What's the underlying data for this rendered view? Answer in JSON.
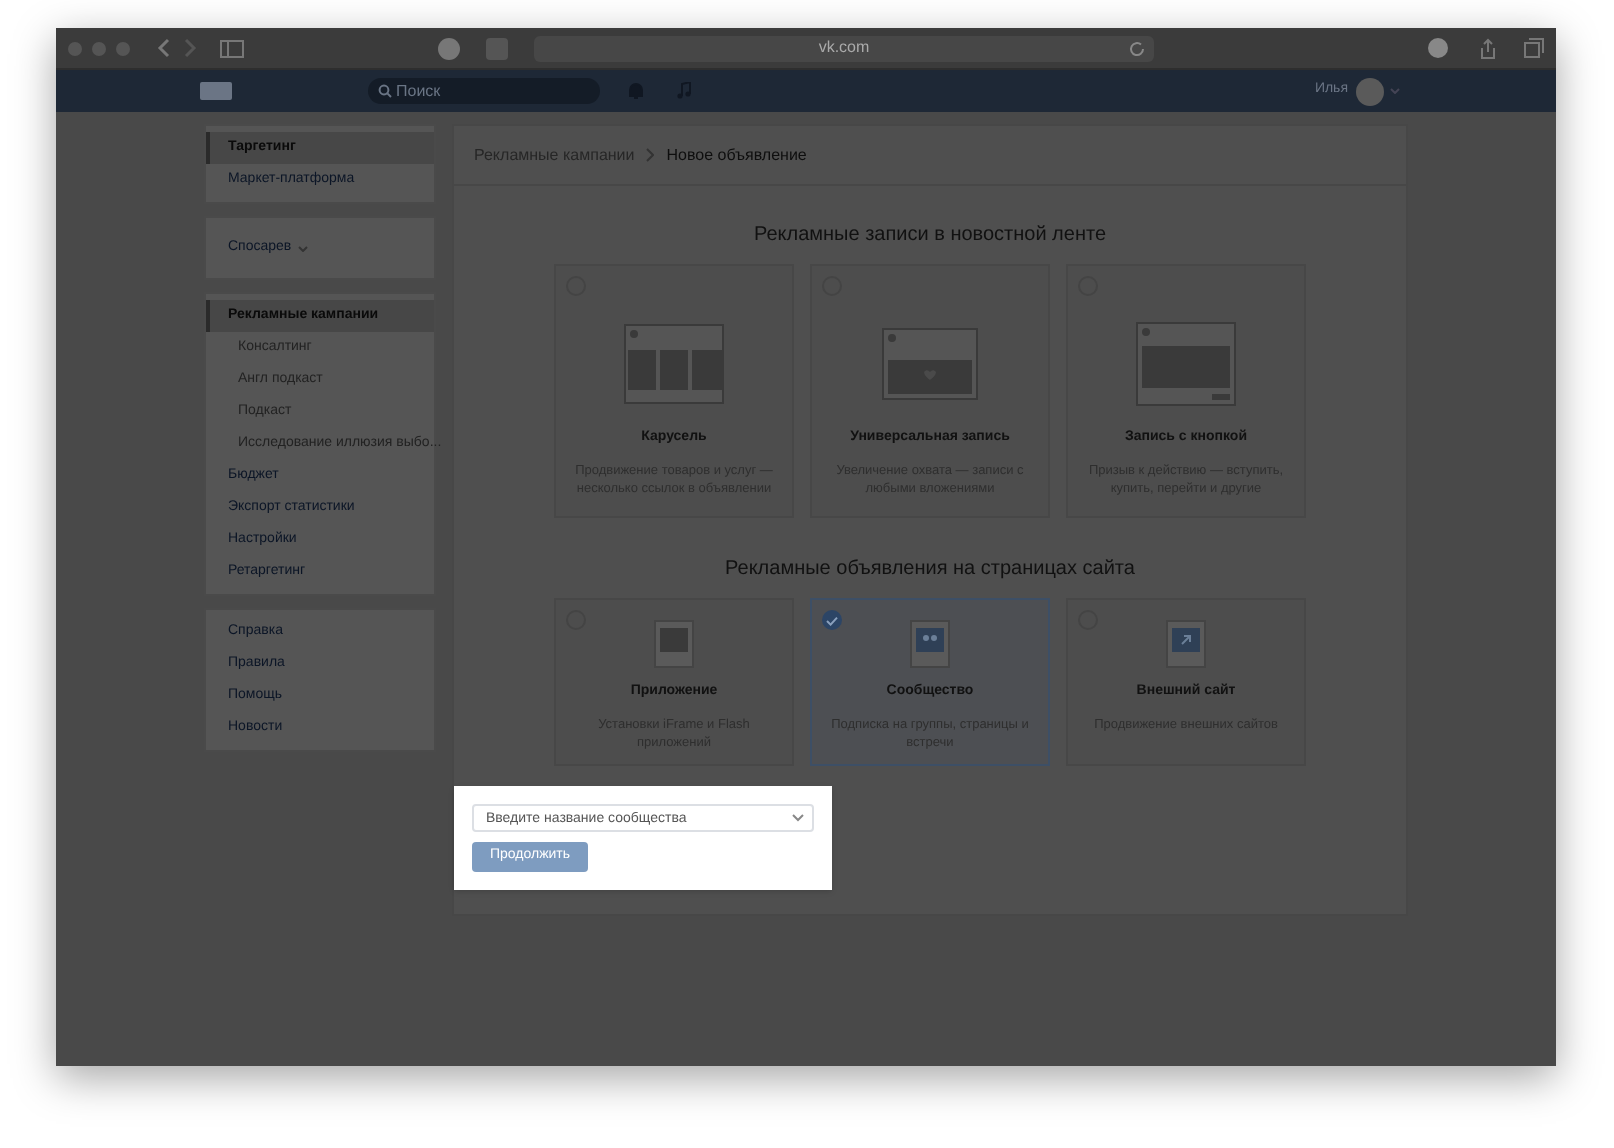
{
  "browser": {
    "url": "vk.com"
  },
  "header": {
    "search_placeholder": "Поиск",
    "user_name": "Илья"
  },
  "sidebar": {
    "groups": [
      [
        {
          "label": "Таргетинг",
          "kind": "link",
          "selected": true
        },
        {
          "label": "Маркет-платформа",
          "kind": "link",
          "selected": false
        }
      ],
      [
        {
          "label": "Спосарев",
          "kind": "dropdown",
          "selected": false
        }
      ],
      [
        {
          "label": "Рекламные кампании",
          "kind": "link",
          "selected": true
        },
        {
          "label": "Консалтинг",
          "kind": "sub",
          "selected": false
        },
        {
          "label": "Англ подкаст",
          "kind": "sub",
          "selected": false
        },
        {
          "label": "Подкаст",
          "kind": "sub",
          "selected": false
        },
        {
          "label": "Исследование иллюзия выбо...",
          "kind": "sub",
          "selected": false
        },
        {
          "label": "Бюджет",
          "kind": "link",
          "selected": false
        },
        {
          "label": "Экспорт статистики",
          "kind": "link",
          "selected": false
        },
        {
          "label": "Настройки",
          "kind": "link",
          "selected": false
        },
        {
          "label": "Ретаргетинг",
          "kind": "link",
          "selected": false
        }
      ],
      [
        {
          "label": "Справка",
          "kind": "help",
          "selected": false
        },
        {
          "label": "Правила",
          "kind": "help",
          "selected": false
        },
        {
          "label": "Помощь",
          "kind": "help",
          "selected": false
        },
        {
          "label": "Новости",
          "kind": "help",
          "selected": false
        }
      ]
    ]
  },
  "breadcrumbs": [
    "Рекламные кампании",
    "Новое объявление"
  ],
  "sections": [
    {
      "title": "Рекламные записи в новостной ленте",
      "cards": [
        {
          "kind": "carousel",
          "title": "Карусель",
          "description": "Продвижение товаров и услуг — несколько ссылок в объявлении",
          "selected": false
        },
        {
          "kind": "universal",
          "title": "Универсальная запись",
          "description": "Увеличение охвата — записи с любыми вложениями",
          "selected": false
        },
        {
          "kind": "button",
          "title": "Запись с кнопкой",
          "description": "Призыв к действию — вступить, купить, перейти и другие",
          "selected": false
        }
      ]
    },
    {
      "title": "Рекламные объявления на страницах сайта",
      "cards": [
        {
          "kind": "app",
          "title": "Приложение",
          "description": "Установки iFrame и Flash приложений",
          "selected": false
        },
        {
          "kind": "community",
          "title": "Сообщество",
          "description": "Подписка на группы, страницы и встречи",
          "selected": true
        },
        {
          "kind": "site",
          "title": "Внешний сайт",
          "description": "Продвижение внешних сайтов",
          "selected": false
        }
      ]
    }
  ],
  "form": {
    "placeholder": "Введите название сообщества",
    "button": "Продолжить"
  }
}
